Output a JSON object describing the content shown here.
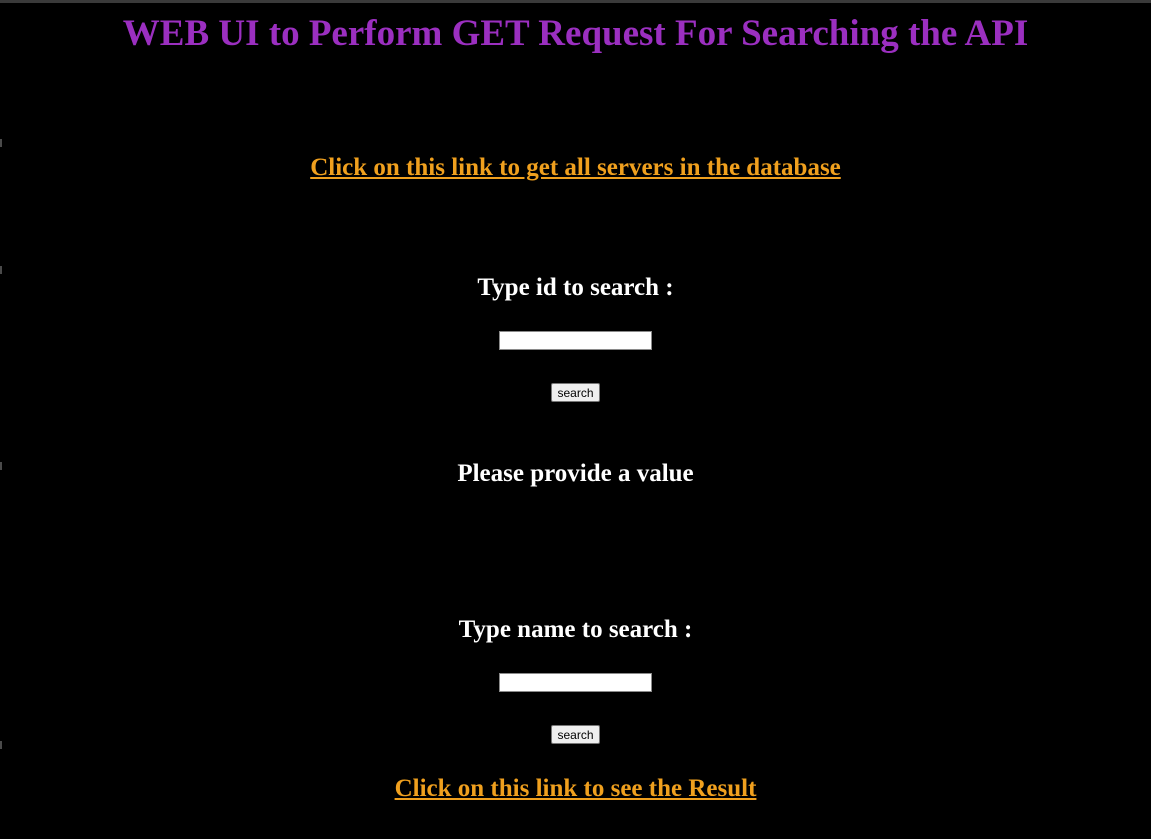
{
  "page": {
    "title": "WEB UI to Perform GET Request For Searching the API"
  },
  "links": {
    "all_servers": "Click on this link to get all servers in the database",
    "result": "Click on this link to see the Result"
  },
  "search_by_id": {
    "label": "Type id to search :",
    "input_value": "",
    "button_label": "search"
  },
  "validation": {
    "message": "Please provide a value"
  },
  "search_by_name": {
    "label": "Type name to search :",
    "input_value": "",
    "button_label": "search"
  },
  "colors": {
    "background": "#000000",
    "title": "#9b2fc0",
    "link": "#f0a01e",
    "label": "#ffffff"
  }
}
